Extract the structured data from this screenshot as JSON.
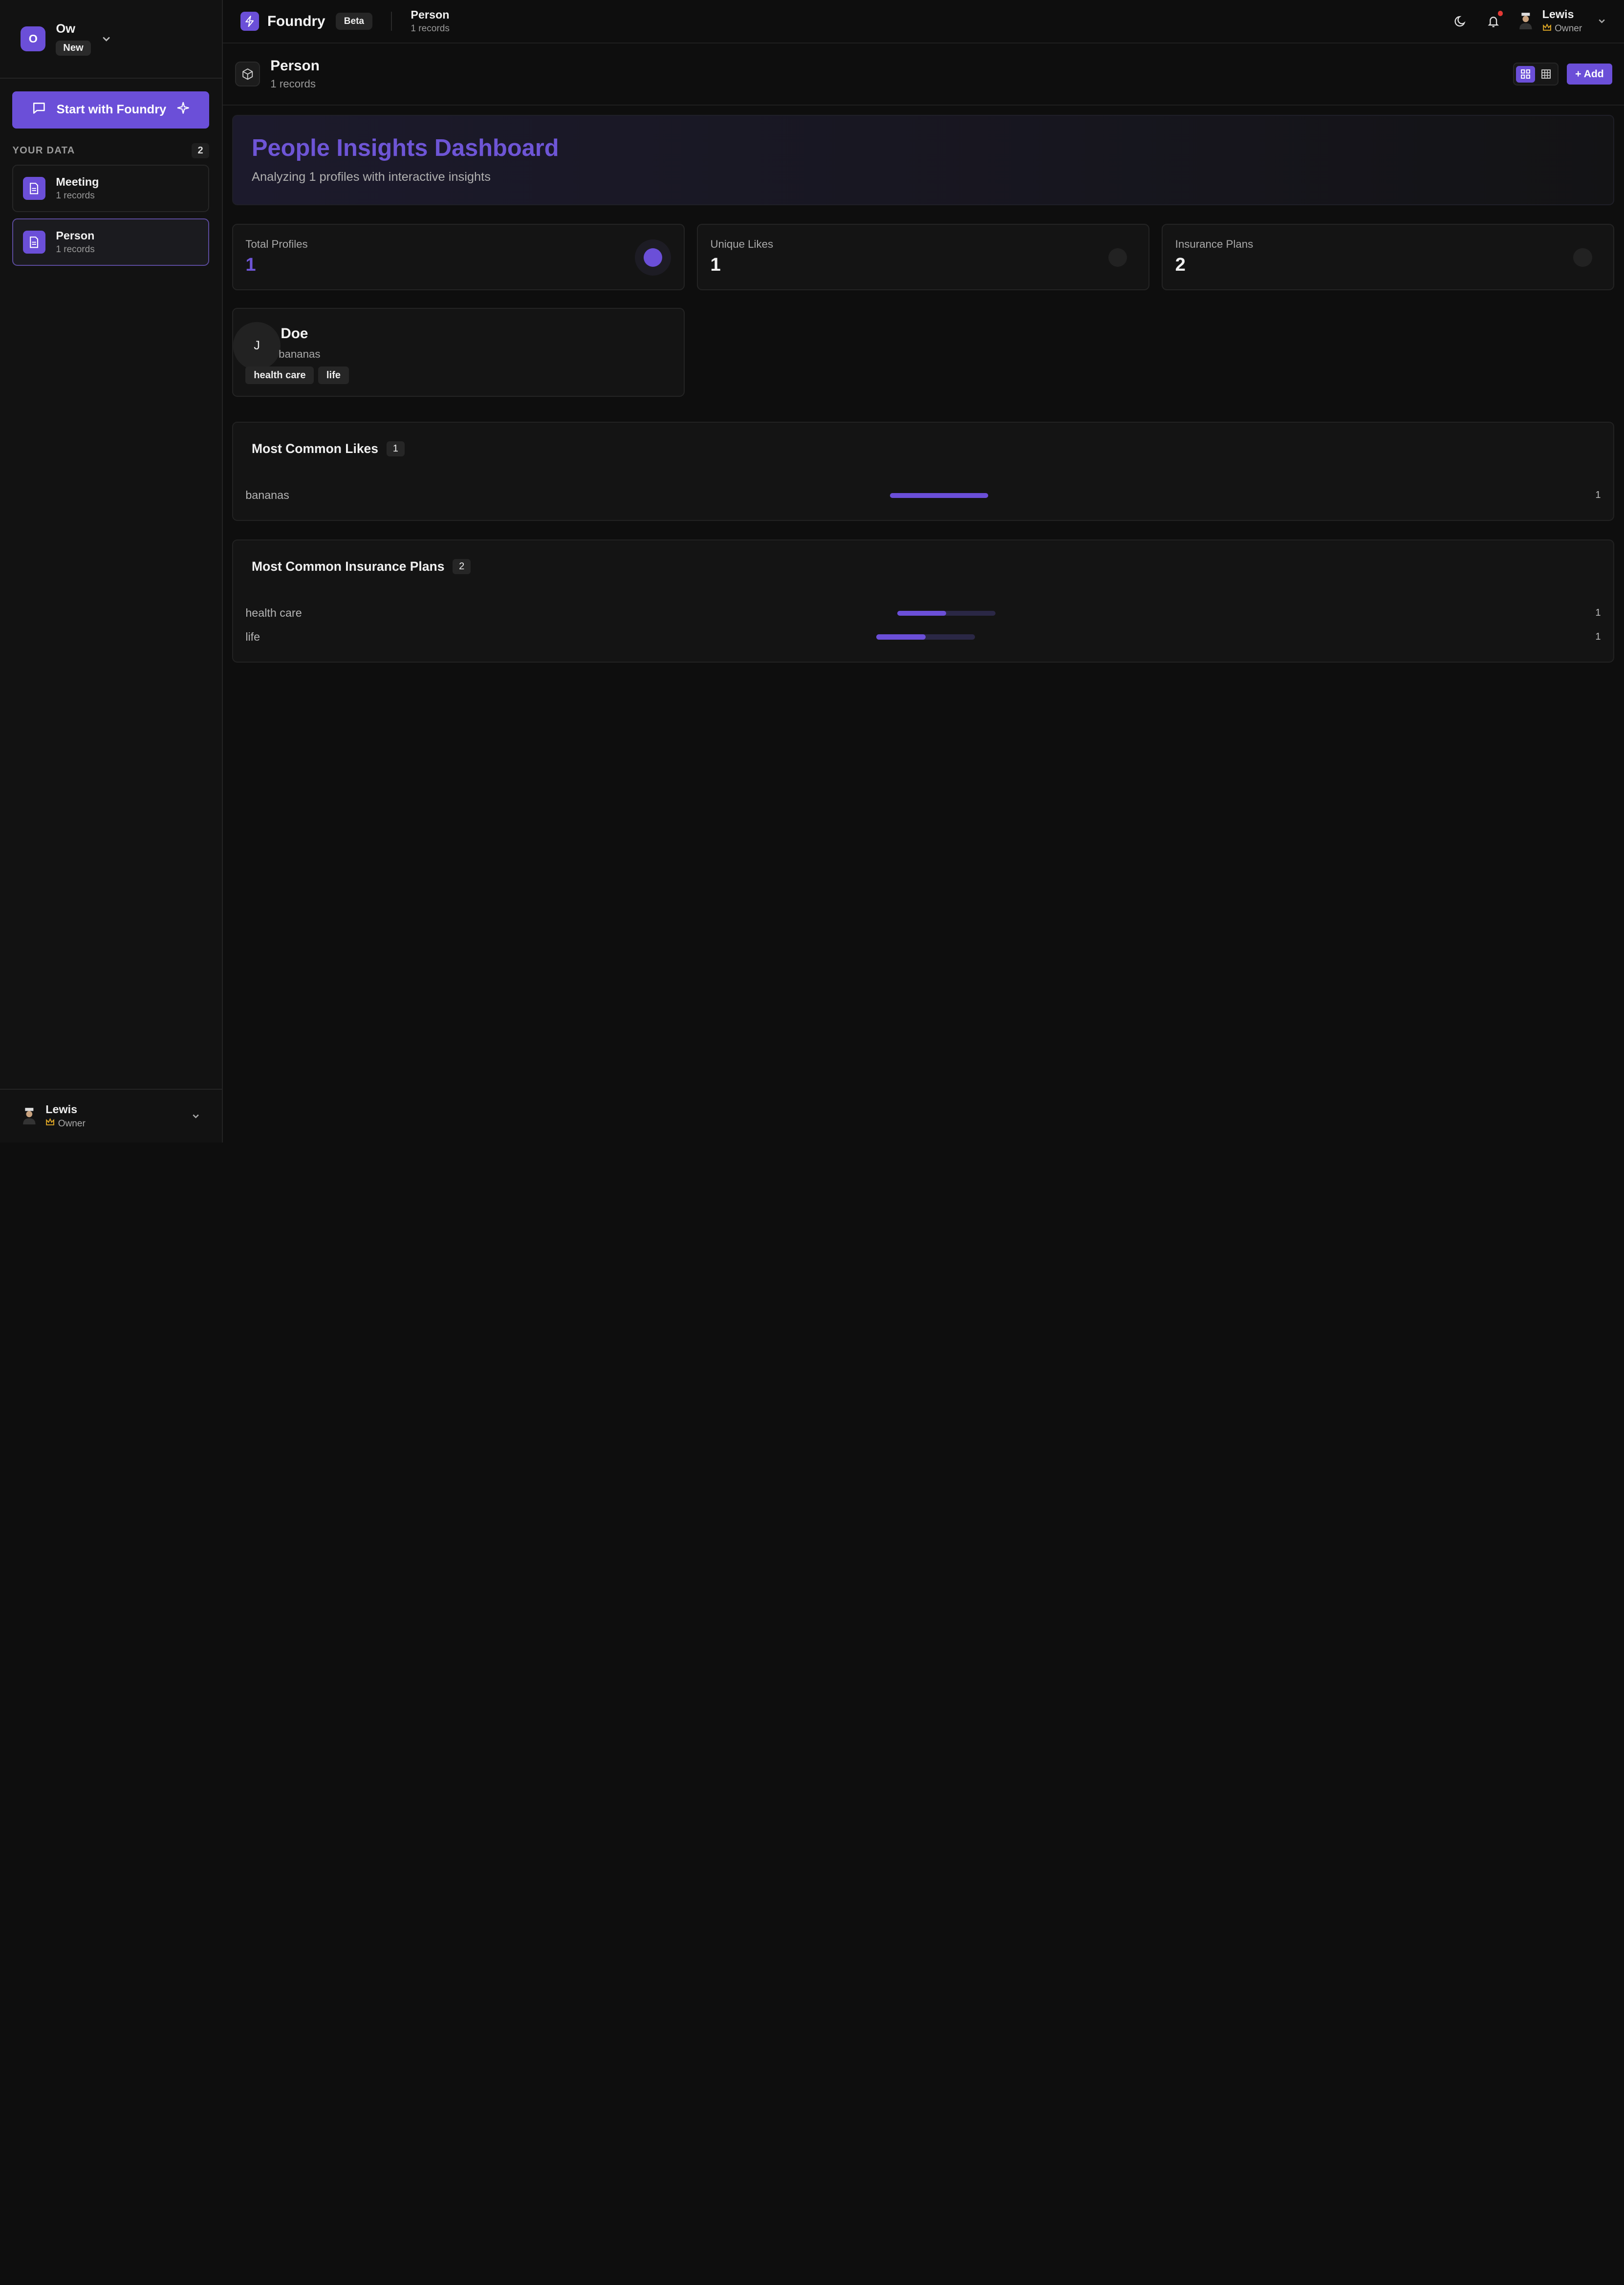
{
  "workspace": {
    "initial": "O",
    "name": "Ow",
    "badge": "New"
  },
  "sidebar": {
    "start_label": "Start with Foundry",
    "section_label": "YOUR DATA",
    "section_count": "2",
    "items": [
      {
        "title": "Meeting",
        "sub": "1 records"
      },
      {
        "title": "Person",
        "sub": "1 records"
      }
    ],
    "user": {
      "name": "Lewis",
      "role": "Owner"
    }
  },
  "topbar": {
    "brand": "Foundry",
    "beta": "Beta",
    "crumb_title": "Person",
    "crumb_sub": "1 records",
    "user": {
      "name": "Lewis",
      "role": "Owner"
    }
  },
  "page": {
    "title": "Person",
    "sub": "1 records",
    "add_label": "+ Add"
  },
  "hero": {
    "title": "People Insights Dashboard",
    "subtitle": "Analyzing 1 profiles with interactive insights"
  },
  "stats": [
    {
      "label": "Total Profiles",
      "value": "1"
    },
    {
      "label": "Unique Likes",
      "value": "1"
    },
    {
      "label": "Insurance Plans",
      "value": "2"
    }
  ],
  "profile": {
    "initial": "J",
    "name": "Doe",
    "likes": "bananas",
    "tags": [
      "health care",
      "life"
    ]
  },
  "likes_panel": {
    "title": "Most Common Likes",
    "count": "1",
    "rows": [
      {
        "label": "bananas",
        "value": "1",
        "fill": 1.0
      }
    ]
  },
  "plans_panel": {
    "title": "Most Common Insurance Plans",
    "count": "2",
    "rows": [
      {
        "label": "health care",
        "value": "1",
        "fill": 0.5
      },
      {
        "label": "life",
        "value": "1",
        "fill": 0.5
      }
    ]
  },
  "colors": {
    "accent": "#6b4fd8",
    "background": "#0e0e0e",
    "notification": "#e53935"
  }
}
